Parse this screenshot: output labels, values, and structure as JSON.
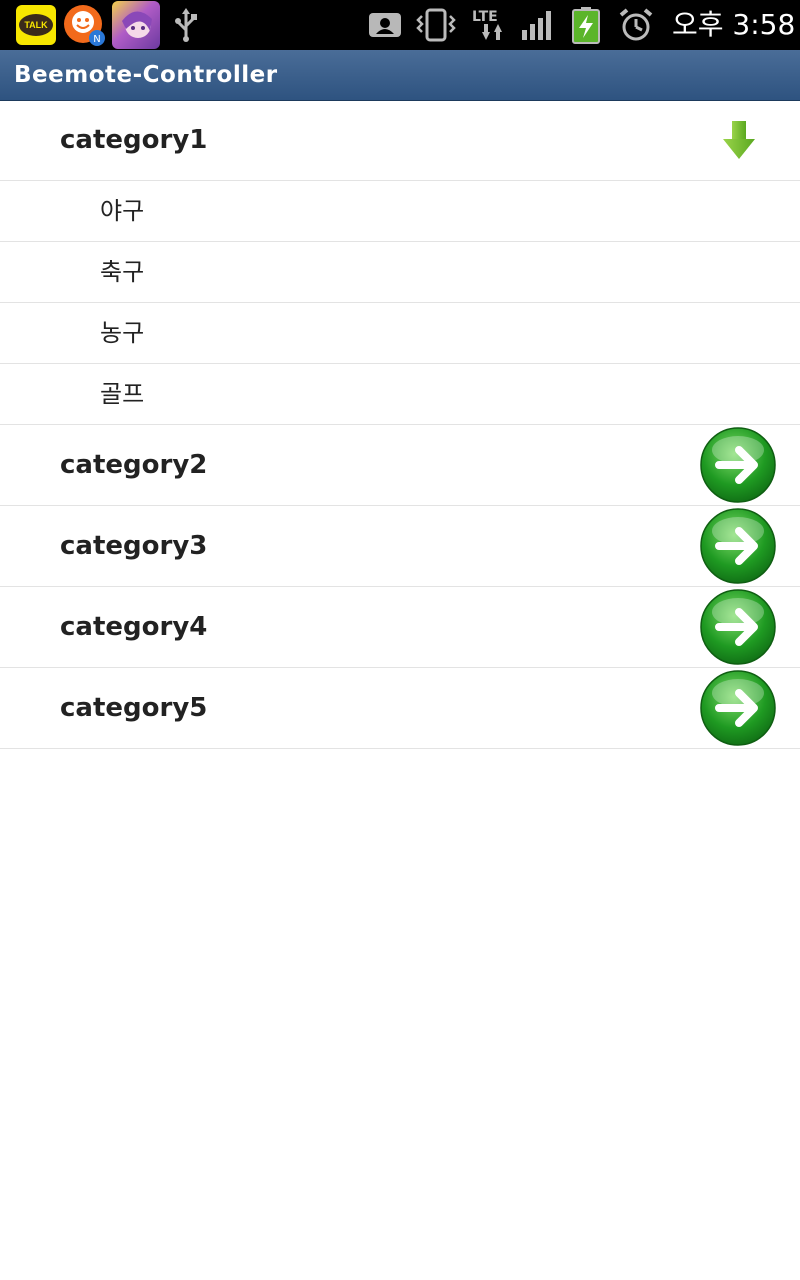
{
  "status_bar": {
    "notification_icons": [
      "kakaotalk-icon",
      "app-notification-icon",
      "game-app-icon",
      "usb-icon"
    ],
    "talk_label": "TALK",
    "system_icons": [
      "contact-card-icon",
      "vibrate-icon",
      "lte-data-icon",
      "signal-icon",
      "battery-charging-icon",
      "alarm-icon"
    ],
    "lte_label": "LTE",
    "clock": "오후 3:58"
  },
  "title_bar": {
    "title": "Beemote-Controller"
  },
  "list": {
    "groups": [
      {
        "label": "category1",
        "expanded": true,
        "indicator": "arrow-down-icon",
        "children": [
          "야구",
          "축구",
          "농구",
          "골프"
        ]
      },
      {
        "label": "category2",
        "expanded": false,
        "indicator": "arrow-right-circle-icon"
      },
      {
        "label": "category3",
        "expanded": false,
        "indicator": "arrow-right-circle-icon"
      },
      {
        "label": "category4",
        "expanded": false,
        "indicator": "arrow-right-circle-icon"
      },
      {
        "label": "category5",
        "expanded": false,
        "indicator": "arrow-right-circle-icon"
      }
    ]
  },
  "colors": {
    "status_bar_bg": "#000000",
    "title_bar_bg": "#3a5f8c",
    "divider": "#e3e3e3",
    "accent_green": "#2ea82e"
  }
}
